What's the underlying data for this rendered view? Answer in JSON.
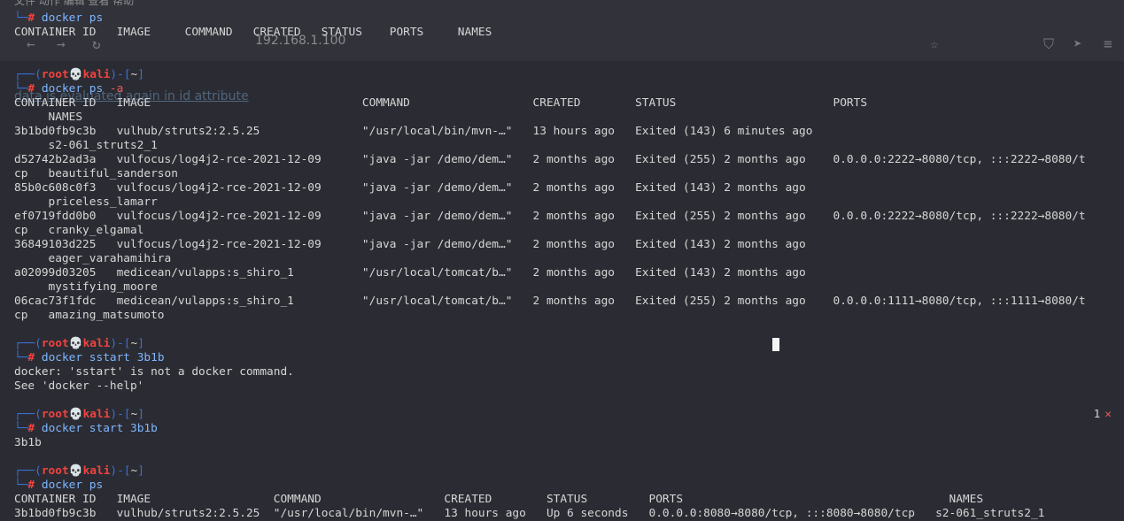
{
  "ghost": {
    "menu": "文件  动作  编辑  查看  帮助",
    "url": "192.168.1.100",
    "link": "data is evaluated again in id attribute"
  },
  "prompt": {
    "top_prefix": "┌──(",
    "user": "root",
    "skull": "💀",
    "host": "kali",
    "mid": ")-[",
    "dir": "~",
    "end": "]",
    "bottom_prefix": "└─",
    "hash": "#"
  },
  "blocks": [
    {
      "command": "",
      "output": [],
      "first_line": {
        "cmd": "docker ps",
        "with_prompt_top": false
      }
    }
  ],
  "ps1": {
    "cmd": "docker ps",
    "header": "CONTAINER ID   IMAGE     COMMAND   CREATED   STATUS    PORTS     NAMES"
  },
  "ps_a": {
    "cmd": "docker ps",
    "flag": "-a",
    "lines": [
      "CONTAINER ID   IMAGE                               COMMAND                  CREATED        STATUS                       PORTS                                             ",
      "     NAMES",
      "3b1bd0fb9c3b   vulhub/struts2:2.5.25               \"/usr/local/bin/mvn-…\"   13 hours ago   Exited (143) 6 minutes ago                                                     ",
      "     s2-061_struts2_1",
      "d52742b2ad3a   vulfocus/log4j2-rce-2021-12-09      \"java -jar /demo/dem…\"   2 months ago   Exited (255) 2 months ago    0.0.0.0:2222→8080/tcp, :::2222→8080/t",
      "cp   beautiful_sanderson",
      "85b0c608c0f3   vulfocus/log4j2-rce-2021-12-09      \"java -jar /demo/dem…\"   2 months ago   Exited (143) 2 months ago                                                      ",
      "     priceless_lamarr",
      "ef0719fdd0b0   vulfocus/log4j2-rce-2021-12-09      \"java -jar /demo/dem…\"   2 months ago   Exited (255) 2 months ago    0.0.0.0:2222→8080/tcp, :::2222→8080/t",
      "cp   cranky_elgamal",
      "36849103d225   vulfocus/log4j2-rce-2021-12-09      \"java -jar /demo/dem…\"   2 months ago   Exited (143) 2 months ago                                                      ",
      "     eager_varahamihira",
      "a02099d03205   medicean/vulapps:s_shiro_1          \"/usr/local/tomcat/b…\"   2 months ago   Exited (143) 2 months ago                                                      ",
      "     mystifying_moore",
      "06cac73f1fdc   medicean/vulapps:s_shiro_1          \"/usr/local/tomcat/b…\"   2 months ago   Exited (255) 2 months ago    0.0.0.0:1111→8080/tcp, :::1111→8080/t",
      "cp   amazing_matsumoto"
    ]
  },
  "sstart": {
    "cmd": "docker sstart 3b1b",
    "lines": [
      "docker: 'sstart' is not a docker command.",
      "See 'docker --help'"
    ]
  },
  "start": {
    "cmd": "docker start 3b1b",
    "lines": [
      "3b1b"
    ],
    "exit_code": "1",
    "exit_mark": "✕"
  },
  "ps2": {
    "cmd": "docker ps",
    "lines": [
      "CONTAINER ID   IMAGE                  COMMAND                  CREATED        STATUS         PORTS                                       NAMES",
      "3b1bd0fb9c3b   vulhub/struts2:2.5.25  \"/usr/local/bin/mvn-…\"   13 hours ago   Up 6 seconds   0.0.0.0:8080→8080/tcp, :::8080→8080/tcp   s2-061_struts2_1"
    ]
  }
}
